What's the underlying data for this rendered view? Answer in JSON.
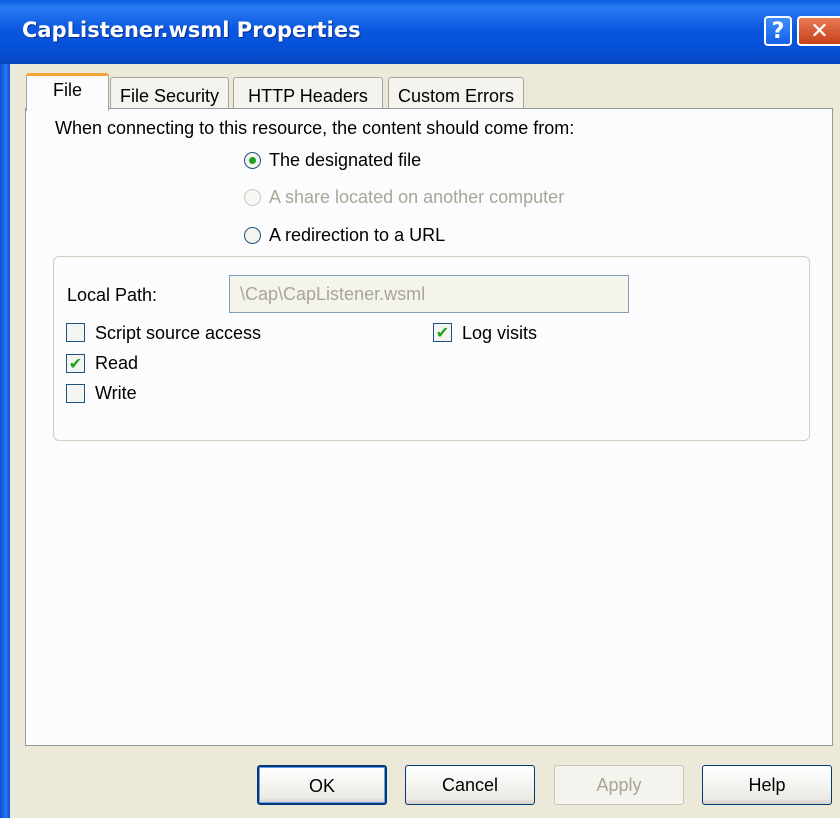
{
  "window": {
    "title": "CapListener.wsml Properties",
    "help_glyph": "?",
    "close_glyph": "✕"
  },
  "tabs": [
    {
      "label": "File",
      "active": true
    },
    {
      "label": "File Security",
      "active": false
    },
    {
      "label": "HTTP Headers",
      "active": false
    },
    {
      "label": "Custom Errors",
      "active": false
    }
  ],
  "file_tab": {
    "content_source_prompt": "When connecting to this resource, the content should come from:",
    "options": [
      {
        "label": "The designated file",
        "selected": true,
        "enabled": true
      },
      {
        "label": "A share located on another computer",
        "selected": false,
        "enabled": false
      },
      {
        "label": "A redirection to a URL",
        "selected": false,
        "enabled": true
      }
    ],
    "local_path_label": "Local Path:",
    "local_path_value": "\\Cap\\CapListener.wsml",
    "checkboxes": [
      {
        "label": "Script source access",
        "checked": false
      },
      {
        "label": "Read",
        "checked": true
      },
      {
        "label": "Write",
        "checked": false
      },
      {
        "label": "Log visits",
        "checked": true
      }
    ],
    "check_glyph": "✔"
  },
  "buttons": {
    "ok": "OK",
    "cancel": "Cancel",
    "apply": "Apply",
    "help": "Help"
  },
  "colors": {
    "titlebar": "#0a58e0",
    "active_tab_accent": "#f1a43a",
    "check_green": "#21a121"
  }
}
